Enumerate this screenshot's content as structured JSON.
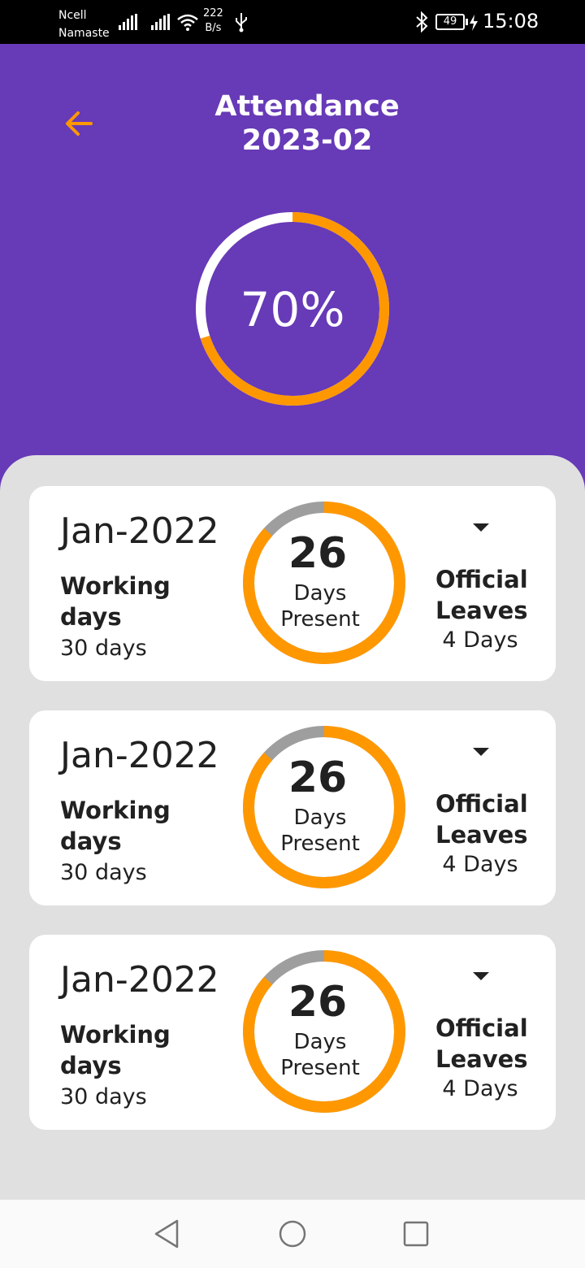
{
  "status_bar": {
    "carrier_line1": "Ncell",
    "carrier_line2": "Namaste",
    "net_speed_value": "222",
    "net_speed_unit": "B/s",
    "battery": "49",
    "time": "15:08"
  },
  "header": {
    "back_icon": "arrow-left-icon",
    "title_line1": "Attendance",
    "title_line2": "2023-02",
    "overall_percent_text": "70%",
    "overall_percent": 70
  },
  "colors": {
    "primary": "#673ab7",
    "accent": "#ff9800",
    "ring_track_header": "#ffffff",
    "ring_track_card": "#9e9e9e",
    "sheet_bg": "#e0e0e0"
  },
  "cards": [
    {
      "month": "Jan-2022",
      "working_label": "Working days",
      "working_value": "30 days",
      "present_count": "26",
      "present_line1": "Days",
      "present_line2": "Present",
      "present_fraction": 0.8667,
      "dropdown_icon": "caret-down-icon",
      "leaves_label_line1": "Official",
      "leaves_label_line2": "Leaves",
      "leaves_value": "4 Days"
    },
    {
      "month": "Jan-2022",
      "working_label": "Working days",
      "working_value": "30 days",
      "present_count": "26",
      "present_line1": "Days",
      "present_line2": "Present",
      "present_fraction": 0.8667,
      "dropdown_icon": "caret-down-icon",
      "leaves_label_line1": "Official",
      "leaves_label_line2": "Leaves",
      "leaves_value": "4 Days"
    },
    {
      "month": "Jan-2022",
      "working_label": "Working days",
      "working_value": "30 days",
      "present_count": "26",
      "present_line1": "Days",
      "present_line2": "Present",
      "present_fraction": 0.8667,
      "dropdown_icon": "caret-down-icon",
      "leaves_label_line1": "Official",
      "leaves_label_line2": "Leaves",
      "leaves_value": "4 Days"
    }
  ],
  "nav_bar": {
    "back_icon": "triangle-back-icon",
    "home_icon": "circle-home-icon",
    "recents_icon": "square-recents-icon"
  }
}
